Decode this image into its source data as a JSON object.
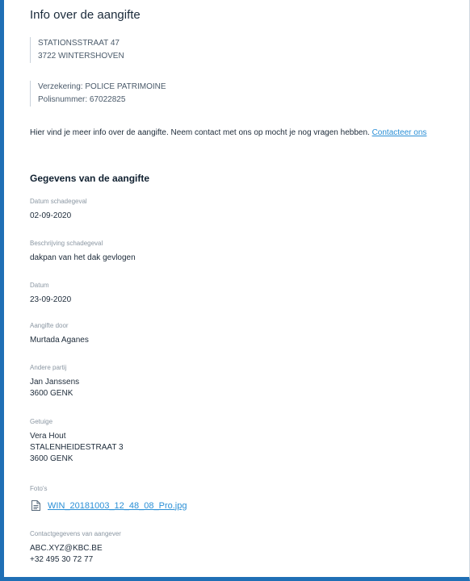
{
  "header": {
    "title": "Info over de aangifte"
  },
  "address": {
    "line1": "STATIONSSTRAAT 47",
    "line2": "3722 WINTERSHOVEN"
  },
  "insurance": {
    "line1": "Verzekering: POLICE PATRIMOINE",
    "line2": "Polisnummer: 67022825"
  },
  "intro": {
    "text": "Hier vind je meer info over de aangifte. Neem contact met ons op mocht je nog vragen hebben.",
    "link": "Contacteer ons"
  },
  "section": {
    "title": "Gegevens van de aangifte"
  },
  "fields": {
    "datum_schadegeval": {
      "label": "Datum schadegeval",
      "value": "02-09-2020"
    },
    "beschrijving": {
      "label": "Beschrijving schadegeval",
      "value": "dakpan van het dak gevlogen"
    },
    "datum": {
      "label": "Datum",
      "value": "23-09-2020"
    },
    "aangifte_door": {
      "label": "Aangifte door",
      "value": "Murtada Aganes"
    },
    "andere_partij": {
      "label": "Andere partij",
      "lines": [
        "Jan Janssens",
        "3600 GENK"
      ]
    },
    "getuige": {
      "label": "Getuige",
      "lines": [
        "Vera Hout",
        "STALENHEIDESTRAAT 3",
        "3600 GENK"
      ]
    },
    "fotos": {
      "label": "Foto's",
      "file": "WIN_20181003_12_48_08_Pro.jpg",
      "icon": "document-icon"
    },
    "contact": {
      "label": "Contactgegevens van aangever",
      "lines": [
        "ABC.XYZ@KBC.BE",
        "+32 495 30 72 77"
      ]
    }
  },
  "colors": {
    "accent": "#1f6fb5",
    "link": "#2a8fd6"
  }
}
